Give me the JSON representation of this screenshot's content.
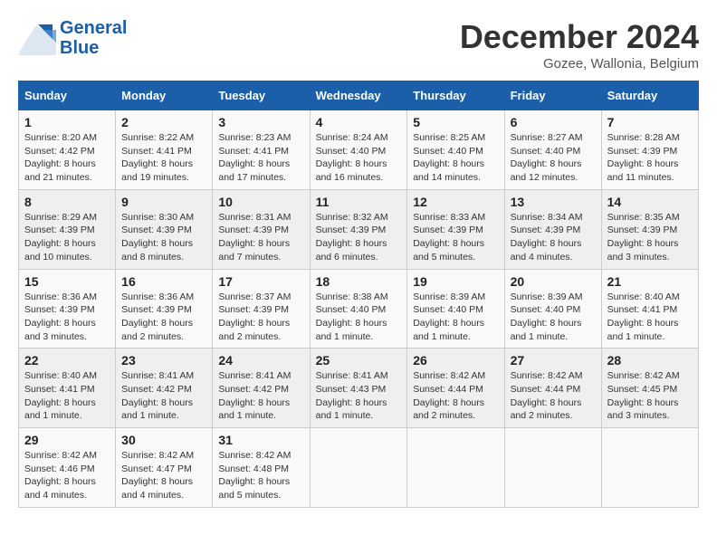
{
  "header": {
    "logo_line1": "General",
    "logo_line2": "Blue",
    "month": "December 2024",
    "location": "Gozee, Wallonia, Belgium"
  },
  "columns": [
    "Sunday",
    "Monday",
    "Tuesday",
    "Wednesday",
    "Thursday",
    "Friday",
    "Saturday"
  ],
  "weeks": [
    [
      {
        "day": 1,
        "sunrise": "8:20 AM",
        "sunset": "4:42 PM",
        "daylight": "8 hours and 21 minutes."
      },
      {
        "day": 2,
        "sunrise": "8:22 AM",
        "sunset": "4:41 PM",
        "daylight": "8 hours and 19 minutes."
      },
      {
        "day": 3,
        "sunrise": "8:23 AM",
        "sunset": "4:41 PM",
        "daylight": "8 hours and 17 minutes."
      },
      {
        "day": 4,
        "sunrise": "8:24 AM",
        "sunset": "4:40 PM",
        "daylight": "8 hours and 16 minutes."
      },
      {
        "day": 5,
        "sunrise": "8:25 AM",
        "sunset": "4:40 PM",
        "daylight": "8 hours and 14 minutes."
      },
      {
        "day": 6,
        "sunrise": "8:27 AM",
        "sunset": "4:40 PM",
        "daylight": "8 hours and 12 minutes."
      },
      {
        "day": 7,
        "sunrise": "8:28 AM",
        "sunset": "4:39 PM",
        "daylight": "8 hours and 11 minutes."
      }
    ],
    [
      {
        "day": 8,
        "sunrise": "8:29 AM",
        "sunset": "4:39 PM",
        "daylight": "8 hours and 10 minutes."
      },
      {
        "day": 9,
        "sunrise": "8:30 AM",
        "sunset": "4:39 PM",
        "daylight": "8 hours and 8 minutes."
      },
      {
        "day": 10,
        "sunrise": "8:31 AM",
        "sunset": "4:39 PM",
        "daylight": "8 hours and 7 minutes."
      },
      {
        "day": 11,
        "sunrise": "8:32 AM",
        "sunset": "4:39 PM",
        "daylight": "8 hours and 6 minutes."
      },
      {
        "day": 12,
        "sunrise": "8:33 AM",
        "sunset": "4:39 PM",
        "daylight": "8 hours and 5 minutes."
      },
      {
        "day": 13,
        "sunrise": "8:34 AM",
        "sunset": "4:39 PM",
        "daylight": "8 hours and 4 minutes."
      },
      {
        "day": 14,
        "sunrise": "8:35 AM",
        "sunset": "4:39 PM",
        "daylight": "8 hours and 3 minutes."
      }
    ],
    [
      {
        "day": 15,
        "sunrise": "8:36 AM",
        "sunset": "4:39 PM",
        "daylight": "8 hours and 3 minutes."
      },
      {
        "day": 16,
        "sunrise": "8:36 AM",
        "sunset": "4:39 PM",
        "daylight": "8 hours and 2 minutes."
      },
      {
        "day": 17,
        "sunrise": "8:37 AM",
        "sunset": "4:39 PM",
        "daylight": "8 hours and 2 minutes."
      },
      {
        "day": 18,
        "sunrise": "8:38 AM",
        "sunset": "4:40 PM",
        "daylight": "8 hours and 1 minute."
      },
      {
        "day": 19,
        "sunrise": "8:39 AM",
        "sunset": "4:40 PM",
        "daylight": "8 hours and 1 minute."
      },
      {
        "day": 20,
        "sunrise": "8:39 AM",
        "sunset": "4:40 PM",
        "daylight": "8 hours and 1 minute."
      },
      {
        "day": 21,
        "sunrise": "8:40 AM",
        "sunset": "4:41 PM",
        "daylight": "8 hours and 1 minute."
      }
    ],
    [
      {
        "day": 22,
        "sunrise": "8:40 AM",
        "sunset": "4:41 PM",
        "daylight": "8 hours and 1 minute."
      },
      {
        "day": 23,
        "sunrise": "8:41 AM",
        "sunset": "4:42 PM",
        "daylight": "8 hours and 1 minute."
      },
      {
        "day": 24,
        "sunrise": "8:41 AM",
        "sunset": "4:42 PM",
        "daylight": "8 hours and 1 minute."
      },
      {
        "day": 25,
        "sunrise": "8:41 AM",
        "sunset": "4:43 PM",
        "daylight": "8 hours and 1 minute."
      },
      {
        "day": 26,
        "sunrise": "8:42 AM",
        "sunset": "4:44 PM",
        "daylight": "8 hours and 2 minutes."
      },
      {
        "day": 27,
        "sunrise": "8:42 AM",
        "sunset": "4:44 PM",
        "daylight": "8 hours and 2 minutes."
      },
      {
        "day": 28,
        "sunrise": "8:42 AM",
        "sunset": "4:45 PM",
        "daylight": "8 hours and 3 minutes."
      }
    ],
    [
      {
        "day": 29,
        "sunrise": "8:42 AM",
        "sunset": "4:46 PM",
        "daylight": "8 hours and 4 minutes."
      },
      {
        "day": 30,
        "sunrise": "8:42 AM",
        "sunset": "4:47 PM",
        "daylight": "8 hours and 4 minutes."
      },
      {
        "day": 31,
        "sunrise": "8:42 AM",
        "sunset": "4:48 PM",
        "daylight": "8 hours and 5 minutes."
      },
      null,
      null,
      null,
      null
    ]
  ]
}
